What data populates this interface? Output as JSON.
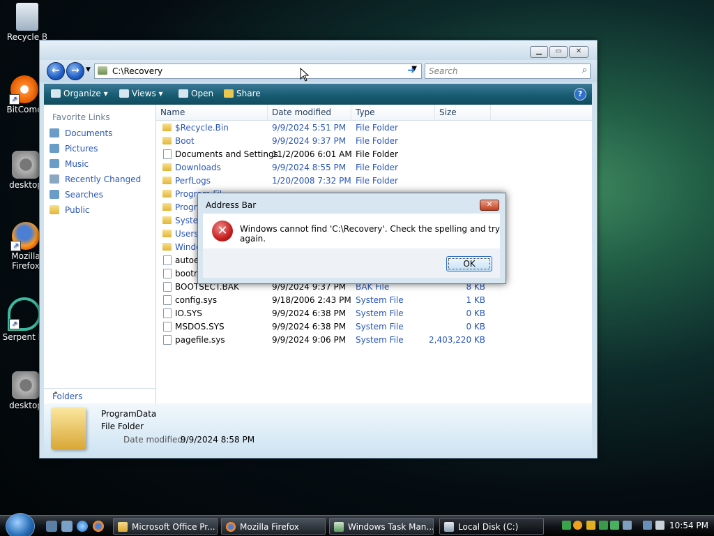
{
  "desktop": {
    "icons": [
      {
        "label": "Recycle B",
        "icon": "recycle-bin-icon"
      },
      {
        "label": "BitCome",
        "icon": "bitcomet-icon"
      },
      {
        "label": "desktop",
        "icon": "gear-file-icon"
      },
      {
        "label": "Mozilla Firefox",
        "icon": "firefox-icon"
      },
      {
        "label": "Serpent IA",
        "icon": "serpent-icon"
      },
      {
        "label": "desktop",
        "icon": "gear-file-icon"
      }
    ]
  },
  "explorer": {
    "address": "C:\\Recovery",
    "search_placeholder": "Search",
    "toolbar": {
      "organize": "Organize",
      "views": "Views",
      "open": "Open",
      "share": "Share"
    },
    "favorite_links_header": "Favorite Links",
    "favorite_links": [
      "Documents",
      "Pictures",
      "Music",
      "Recently Changed",
      "Searches",
      "Public"
    ],
    "folders_label": "Folders",
    "columns": [
      "Name",
      "Date modified",
      "Type",
      "Size"
    ],
    "rows": [
      {
        "name": "$Recycle.Bin",
        "date": "9/9/2024 5:51 PM",
        "type": "File Folder",
        "size": "",
        "kind": "folder"
      },
      {
        "name": "Boot",
        "date": "9/9/2024 9:37 PM",
        "type": "File Folder",
        "size": "",
        "kind": "folder"
      },
      {
        "name": "Documents and Settings",
        "date": "11/2/2006 6:01 AM",
        "type": "File Folder",
        "size": "",
        "kind": "junction"
      },
      {
        "name": "Downloads",
        "date": "9/9/2024 8:55 PM",
        "type": "File Folder",
        "size": "",
        "kind": "folder"
      },
      {
        "name": "PerfLogs",
        "date": "1/20/2008 7:32 PM",
        "type": "File Folder",
        "size": "",
        "kind": "folder"
      },
      {
        "name": "Program Fil",
        "date": "",
        "type": "",
        "size": "",
        "kind": "folder"
      },
      {
        "name": "Progra",
        "date": "",
        "type": "",
        "size": "",
        "kind": "folder"
      },
      {
        "name": "System",
        "date": "",
        "type": "",
        "size": "",
        "kind": "folder"
      },
      {
        "name": "Users",
        "date": "",
        "type": "",
        "size": "",
        "kind": "folder"
      },
      {
        "name": "Windo",
        "date": "",
        "type": "",
        "size": "",
        "kind": "folder"
      },
      {
        "name": "autoex",
        "date": "",
        "type": "",
        "size": "",
        "kind": "file"
      },
      {
        "name": "bootm",
        "date": "",
        "type": "",
        "size": "",
        "kind": "file"
      },
      {
        "name": "BOOTSECT.BAK",
        "date": "9/9/2024 9:37 PM",
        "type": "BAK File",
        "size": "8 KB",
        "kind": "file"
      },
      {
        "name": "config.sys",
        "date": "9/18/2006 2:43 PM",
        "type": "System File",
        "size": "1 KB",
        "kind": "file"
      },
      {
        "name": "IO.SYS",
        "date": "9/9/2024 6:38 PM",
        "type": "System File",
        "size": "0 KB",
        "kind": "file"
      },
      {
        "name": "MSDOS.SYS",
        "date": "9/9/2024 6:38 PM",
        "type": "System File",
        "size": "0 KB",
        "kind": "file"
      },
      {
        "name": "pagefile.sys",
        "date": "9/9/2024 9:06 PM",
        "type": "System File",
        "size": "2,403,220 KB",
        "kind": "file"
      }
    ],
    "details": {
      "name": "ProgramData",
      "type": "File Folder",
      "date_label": "Date modified:",
      "date": "9/9/2024 8:58 PM"
    }
  },
  "dialog": {
    "title": "Address Bar",
    "message": "Windows cannot find 'C:\\Recovery'. Check the spelling and try again.",
    "ok": "OK"
  },
  "taskbar": {
    "buttons": [
      {
        "label": "Microsoft Office Pr..."
      },
      {
        "label": "Mozilla Firefox"
      },
      {
        "label": "Windows Task Man..."
      },
      {
        "label": "Local Disk (C:)"
      }
    ],
    "clock": "10:54 PM"
  }
}
